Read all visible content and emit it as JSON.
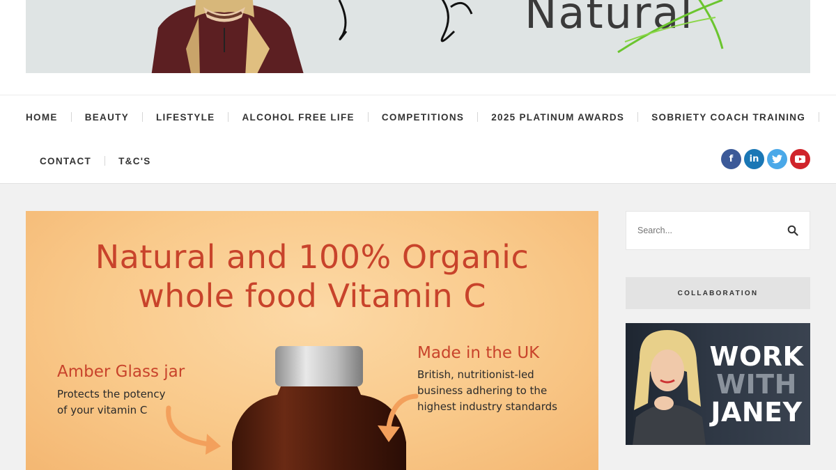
{
  "banner": {
    "logo_text": "Natural"
  },
  "nav": {
    "row1": [
      "HOME",
      "BEAUTY",
      "LIFESTYLE",
      "ALCOHOL FREE LIFE",
      "COMPETITIONS",
      "2025 PLATINUM AWARDS",
      "SOBRIETY COACH TRAINING"
    ],
    "row2": [
      "CONTACT",
      "T&C'S"
    ]
  },
  "social": {
    "facebook": "f",
    "linkedin": "in",
    "twitter_icon": "twitter-bird-icon",
    "youtube_icon": "youtube-play-icon"
  },
  "hero": {
    "title_line1": "Natural and 100% Organic",
    "title_line2": "whole food Vitamin C",
    "left_heading": "Amber Glass jar",
    "left_body_line1": "Protects the potency",
    "left_body_line2": "of your vitamin C",
    "right_heading": "Made in the UK",
    "right_body_line1": "British, nutritionist-led",
    "right_body_line2": "business adhering to the",
    "right_body_line3": "highest industry standards"
  },
  "sidebar": {
    "search_placeholder": "Search...",
    "collab_heading": "COLLABORATION",
    "promo_line1": "WORK",
    "promo_line2": "WITH",
    "promo_line3": "JANEY"
  },
  "colors": {
    "hero_title": "#c8432b",
    "facebook": "#3b5998",
    "linkedin": "#1a77b5",
    "twitter": "#4aa8e8",
    "youtube": "#d0242b"
  }
}
